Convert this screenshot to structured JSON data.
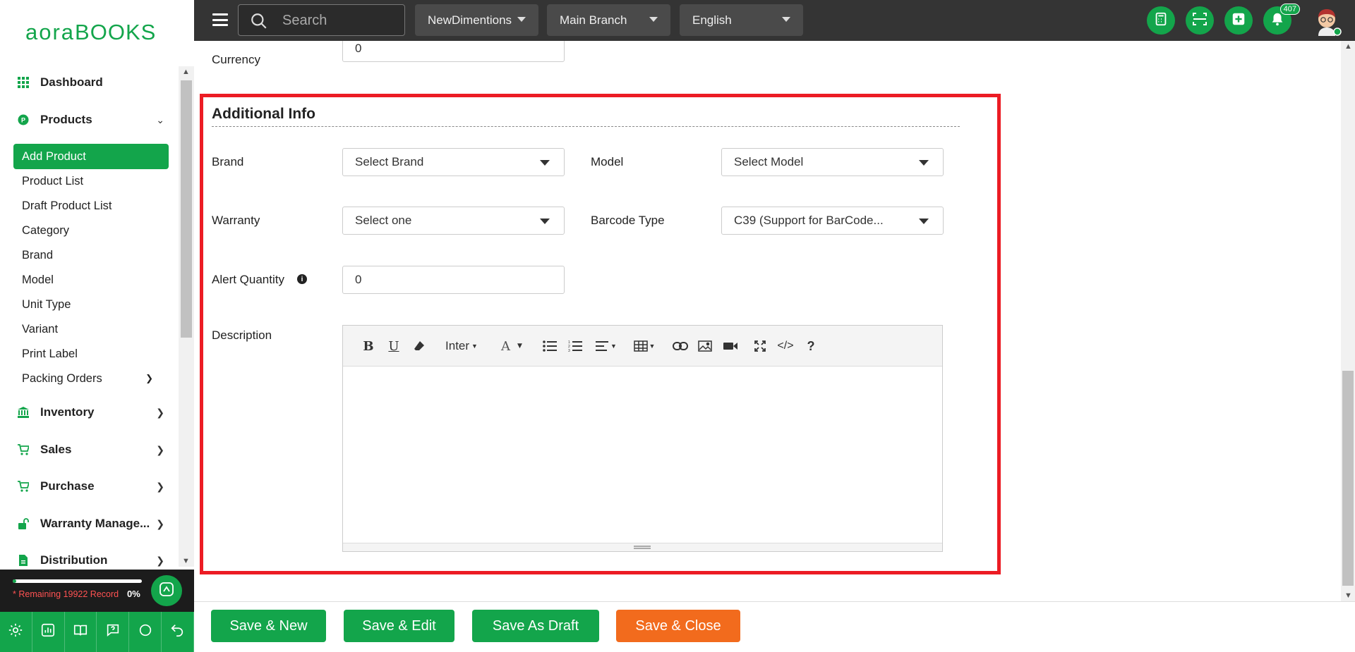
{
  "logo": {
    "part1": "aora",
    "part2": "BOOKS"
  },
  "sidebar": {
    "items": [
      {
        "label": "Dashboard",
        "icon": "grid-icon"
      },
      {
        "label": "Products",
        "icon": "products-icon"
      },
      {
        "label": "Inventory",
        "icon": "bank-icon"
      },
      {
        "label": "Sales",
        "icon": "cart-icon"
      },
      {
        "label": "Purchase",
        "icon": "cart-icon"
      },
      {
        "label": "Warranty Manage...",
        "icon": "unlock-icon"
      },
      {
        "label": "Distribution",
        "icon": "document-icon"
      }
    ],
    "product_subitems": [
      "Add Product",
      "Product List",
      "Draft Product List",
      "Category",
      "Brand",
      "Model",
      "Unit Type",
      "Variant",
      "Print Label",
      "Packing Orders"
    ],
    "remaining_text": "* Remaining 19922 Record",
    "progress_pct": "0%",
    "progress_value": 0.03
  },
  "topbar": {
    "search_placeholder": "Search",
    "company": "NewDimentions",
    "branch": "Main Branch",
    "language": "English",
    "notification_count": "407"
  },
  "form": {
    "currency_label": "Currency",
    "currency_value": "0",
    "section_title": "Additional Info",
    "brand_label": "Brand",
    "brand_value": "Select Brand",
    "model_label": "Model",
    "model_value": "Select Model",
    "warranty_label": "Warranty",
    "warranty_value": "Select one",
    "barcode_label": "Barcode Type",
    "barcode_value": "C39 (Support for BarCode...",
    "alert_label": "Alert Quantity",
    "alert_value": "0",
    "description_label": "Description",
    "editor_font": "Inter"
  },
  "footer": {
    "save_new": "Save & New",
    "save_edit": "Save & Edit",
    "save_draft": "Save As Draft",
    "save_close": "Save & Close"
  },
  "colors": {
    "brand": "#13a54b",
    "topbar": "#343434",
    "highlight": "#ec1c24",
    "orange": "#f26b1d"
  }
}
